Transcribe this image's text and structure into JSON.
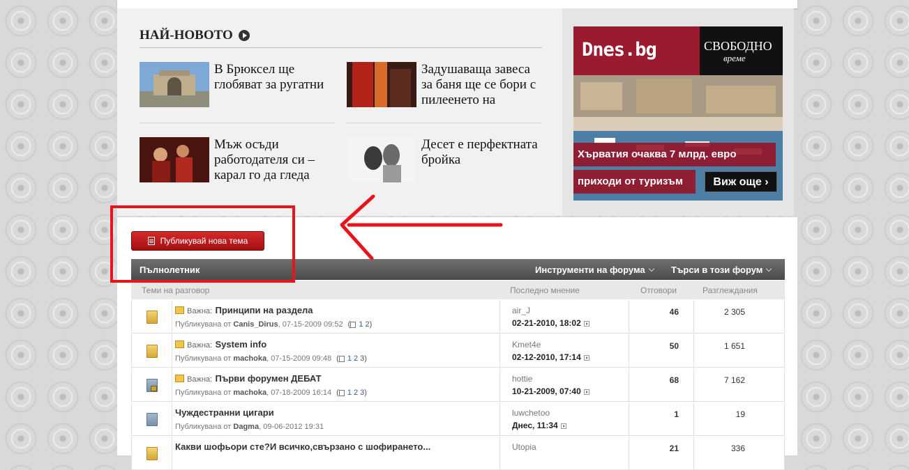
{
  "newest": {
    "title": "НАЙ-НОВОТО",
    "items": [
      {
        "text": "В Брюксел ще глобяват за ругатни"
      },
      {
        "text": "Задушаваща завеса за баня ще се бори с пилеенето на"
      },
      {
        "text": "Мъж осъди работодателя си – карал го да гледа"
      },
      {
        "text": "Десет е перфектната бройка"
      }
    ]
  },
  "ad": {
    "logo": "Dnes.bg",
    "brand": "СВОБОДНО",
    "brand_sub": "време",
    "caption1": "Хърватия очаква 7 млрд. евро",
    "caption2": "приходи от туризъм",
    "more": "Виж още"
  },
  "forum": {
    "new_topic_label": "Публикувай нова тема",
    "title": "Пълнолетник",
    "tools_label": "Инструменти на форума",
    "search_label": "Търси в този форум",
    "columns": {
      "topics": "Теми на разговор",
      "last_post": "Последно мнение",
      "replies": "Отговори",
      "views": "Разглеждания"
    },
    "by_label": "Публикувана от",
    "threads": [
      {
        "prefix": "Важна:",
        "title": "Принципи на раздела",
        "author": "Canis_Dirus",
        "date": "07-15-2009 09:52",
        "pages": [
          "1",
          "2"
        ],
        "last_user": "air_J",
        "last_date": "02-21-2010, 18:02",
        "replies": "46",
        "views": "2 305"
      },
      {
        "prefix": "Важна:",
        "title": "System info",
        "author": "machoka",
        "date": "07-15-2009 09:48",
        "pages": [
          "1",
          "2",
          "3"
        ],
        "last_user": "Kmet4e",
        "last_date": "02-12-2010, 17:14",
        "replies": "50",
        "views": "1 651"
      },
      {
        "prefix": "Важна:",
        "title": "Първи форумен ДЕБАТ",
        "author": "machoka",
        "date": "07-18-2009 16:14",
        "pages": [
          "1",
          "2",
          "3"
        ],
        "last_user": "hottie",
        "last_date": "10-21-2009, 07:40",
        "replies": "68",
        "views": "7 162"
      },
      {
        "title": "Чуждестранни цигари",
        "author": "Dagma",
        "date": "09-06-2012 19:31",
        "last_user": "luwchetoo",
        "last_date": "Днес, 11:34",
        "replies": "1",
        "views": "19"
      },
      {
        "title": "Какви шофьори сте?И всичко,свързано с шофирането...",
        "last_user": "Utopia",
        "replies": "21",
        "views": "336"
      }
    ]
  },
  "colors": {
    "accent_red": "#c21a1e",
    "annotation": "#e8141c",
    "header_grey": "#5c5c5c"
  }
}
